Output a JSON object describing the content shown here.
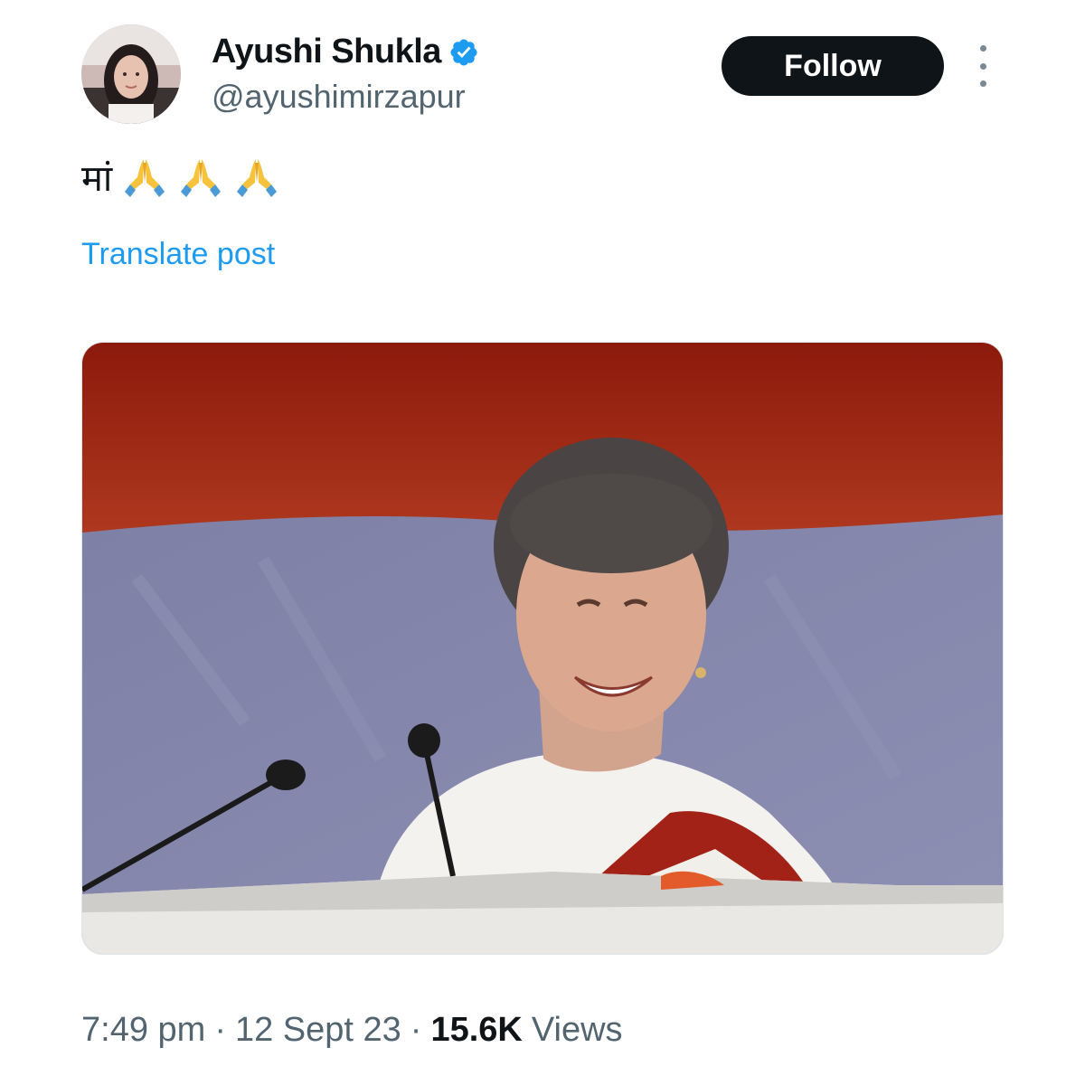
{
  "author": {
    "display_name": "Ayushi Shukla",
    "handle": "@ayushimirzapur",
    "verified": true,
    "avatar_icon": "profile-photo"
  },
  "actions": {
    "follow_label": "Follow",
    "more_icon": "more-vertical-icon"
  },
  "tweet": {
    "text": "मां",
    "emoji": [
      "folded-hands",
      "folded-hands",
      "folded-hands"
    ],
    "translate_label": "Translate post"
  },
  "media": {
    "type": "photo"
  },
  "meta": {
    "time": "7:49 pm",
    "separator": "·",
    "date": "12 Sept 23",
    "views_count": "15.6K",
    "views_label": "Views"
  },
  "colors": {
    "link": "#1d9bf0",
    "verified": "#1d9bf0",
    "text_primary": "#0f1419",
    "text_secondary": "#536471",
    "follow_bg": "#0f1419"
  }
}
